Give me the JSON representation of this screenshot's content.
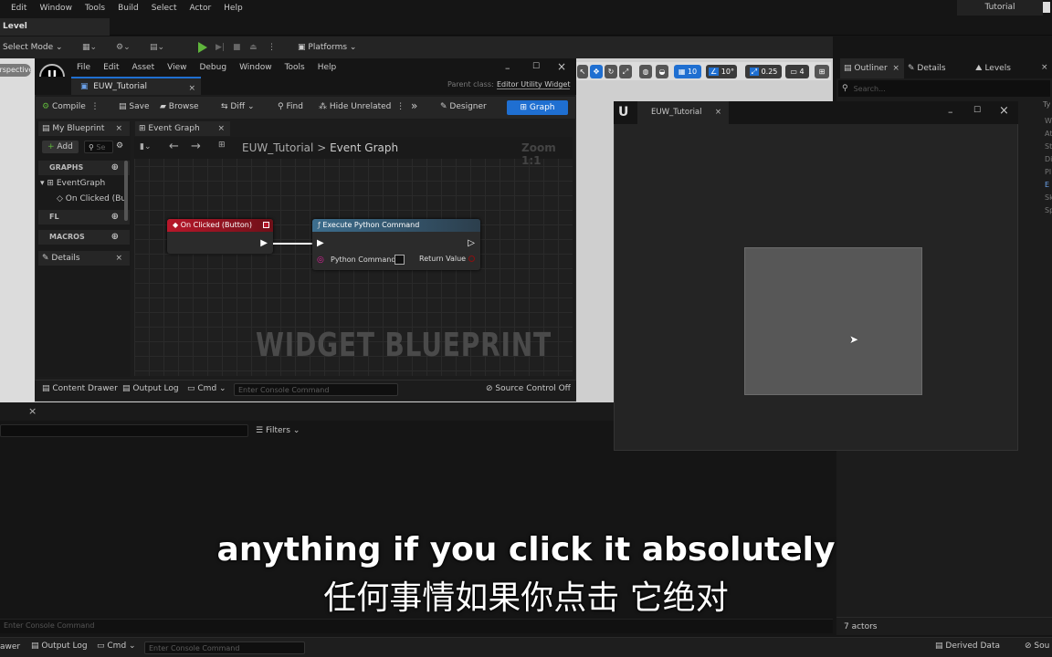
{
  "menubar": {
    "items": [
      "Edit",
      "Window",
      "Tools",
      "Build",
      "Select",
      "Actor",
      "Help"
    ],
    "project_tab": "Tutorial"
  },
  "level_tab": "Level",
  "toolbar": {
    "select_mode": "Select Mode",
    "platforms": "Platforms"
  },
  "viewport": {
    "perspective": "Perspective",
    "grid_snap": "10",
    "rot_snap": "10°",
    "scale_snap": "0.25",
    "camera_speed": "4"
  },
  "blueprint": {
    "menu": [
      "File",
      "Edit",
      "Asset",
      "View",
      "Debug",
      "Window",
      "Tools",
      "Help"
    ],
    "doc_tab": "EUW_Tutorial",
    "parent_class_label": "Parent class:",
    "parent_class": "Editor Utility Widget",
    "toolbar": {
      "compile": "Compile",
      "save": "Save",
      "browse": "Browse",
      "diff": "Diff",
      "find": "Find",
      "hide_unrelated": "Hide Unrelated",
      "designer": "Designer",
      "graph": "Graph"
    },
    "my_blueprint_tab": "My Blueprint",
    "event_graph_tab": "Event Graph",
    "add_label": "Add",
    "search_placeholder": "Se",
    "sections": {
      "graphs": "GRAPHS",
      "fl": "FL",
      "macros": "MACROS",
      "details": "Details"
    },
    "tree": {
      "event_graph": "EventGraph",
      "on_clicked": "On Clicked (But"
    },
    "breadcrumb": {
      "root": "EUW_Tutorial",
      "sep": ">",
      "current": "Event Graph"
    },
    "zoom": "Zoom 1:1",
    "watermark": "WIDGET BLUEPRINT",
    "nodes": {
      "event": {
        "title": "On Clicked (Button)"
      },
      "python": {
        "title": "Execute Python Command",
        "input": "Python Command",
        "output": "Return Value"
      }
    },
    "bottom": {
      "content_drawer": "Content Drawer",
      "output_log": "Output Log",
      "cmd": "Cmd",
      "console_placeholder": "Enter Console Command",
      "source_control": "Source Control Off"
    }
  },
  "popup": {
    "title": "EUW_Tutorial"
  },
  "outliner": {
    "tabs": {
      "outliner": "Outliner",
      "details": "Details",
      "levels": "Levels"
    },
    "search_placeholder": "Search...",
    "col_type": "Ty",
    "side_letters": [
      "W",
      "At",
      "St",
      "Di",
      "Pl",
      "E",
      "Sk",
      "Sp"
    ],
    "actor_count": "7 actors"
  },
  "bottom_panel": {
    "filters": "Filters",
    "console_placeholder": "Enter Console Command"
  },
  "statusbar": {
    "drawer": "awer",
    "output_log": "Output Log",
    "cmd": "Cmd",
    "console_placeholder": "Enter Console Command",
    "derived_data": "Derived Data",
    "source": "Sou"
  },
  "subtitles": {
    "en": "anything if you click it absolutely",
    "zh": "任何事情如果你点击 它绝对"
  }
}
